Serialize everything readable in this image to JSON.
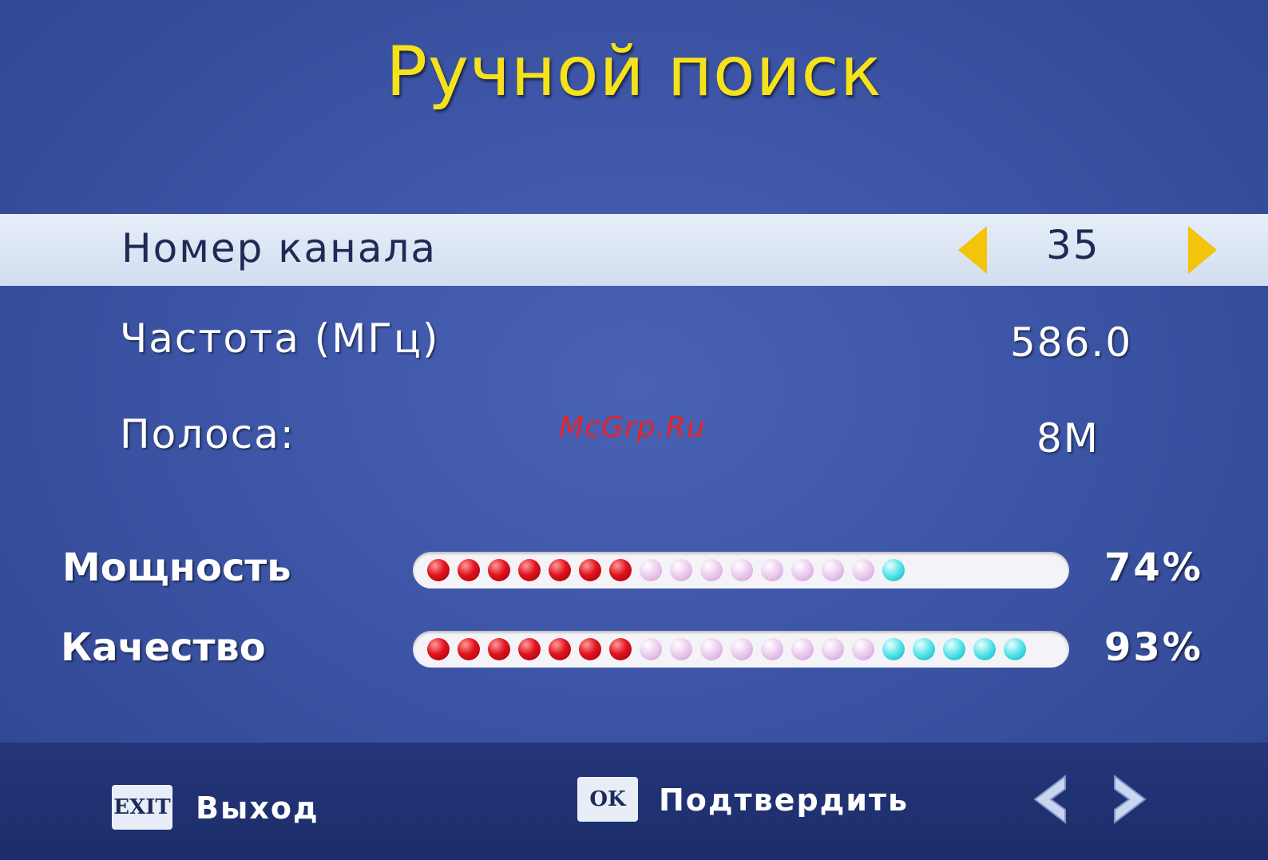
{
  "title": "Ручной поиск",
  "rows": [
    {
      "label": "Номер канала",
      "value": "35",
      "selected": true
    },
    {
      "label": "Частота (МГц)",
      "value": "586.0"
    },
    {
      "label": "Полоса:",
      "value": "8M"
    }
  ],
  "watermark": "McGrp.Ru",
  "meters": [
    {
      "label": "Мощность",
      "percent_text": "74%",
      "level": 0.74,
      "dots": {
        "red": 7,
        "pink": 8,
        "cyan": 1
      }
    },
    {
      "label": "Качество",
      "percent_text": "93%",
      "level": 0.93,
      "dots": {
        "red": 7,
        "pink": 8,
        "cyan": 5
      }
    }
  ],
  "footer": {
    "exit_key": "EXIT",
    "exit_label": "Выход",
    "ok_key": "OK",
    "ok_label": "Подтвердить"
  },
  "colors": {
    "title": "#f6e21a",
    "background": "#3d55a6",
    "selection": "#dfe8f6",
    "arrow": "#f2c40a"
  }
}
